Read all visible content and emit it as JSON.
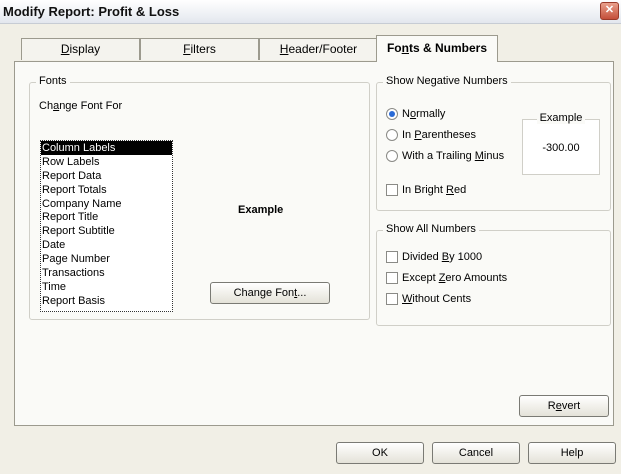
{
  "window": {
    "title": "Modify Report: Profit & Loss",
    "close_glyph": "✕"
  },
  "tabs": [
    {
      "pre": "",
      "u": "D",
      "post": "isplay"
    },
    {
      "pre": "",
      "u": "F",
      "post": "ilters"
    },
    {
      "pre": "",
      "u": "H",
      "post": "eader/Footer"
    },
    {
      "pre": "Fo",
      "u": "n",
      "post": "ts & Numbers"
    }
  ],
  "fonts": {
    "legend": "Fonts",
    "change_for_pre": "Ch",
    "change_for_u": "a",
    "change_for_post": "nge Font For",
    "items": [
      "Column Labels",
      "Row Labels",
      "Report Data",
      "Report Totals",
      "Company Name",
      "Report Title",
      "Report Subtitle",
      "Date",
      "Page Number",
      "Transactions",
      "Time",
      "Report Basis"
    ],
    "example": "Example",
    "change_font_pre": "Change Fon",
    "change_font_u": "t",
    "change_font_post": "..."
  },
  "negative": {
    "legend": "Show Negative Numbers",
    "normally_pre": "N",
    "normally_u": "o",
    "normally_post": "rmally",
    "paren_pre": "In ",
    "paren_u": "P",
    "paren_post": "arentheses",
    "minus_pre": "With a Trailing ",
    "minus_u": "M",
    "minus_post": "inus",
    "example_label": "Example",
    "example_value": "-300.00",
    "red_pre": "In Bright ",
    "red_u": "R",
    "red_post": "ed"
  },
  "all": {
    "legend": "Show All Numbers",
    "div_pre": "Divided ",
    "div_u": "B",
    "div_post": "y 1000",
    "zero_pre": "Except ",
    "zero_u": "Z",
    "zero_post": "ero Amounts",
    "cents_pre": "",
    "cents_u": "W",
    "cents_post": "ithout Cents"
  },
  "revert": {
    "pre": "R",
    "u": "e",
    "post": "vert"
  },
  "footer": {
    "ok": "OK",
    "cancel": "Cancel",
    "help": "Help"
  }
}
